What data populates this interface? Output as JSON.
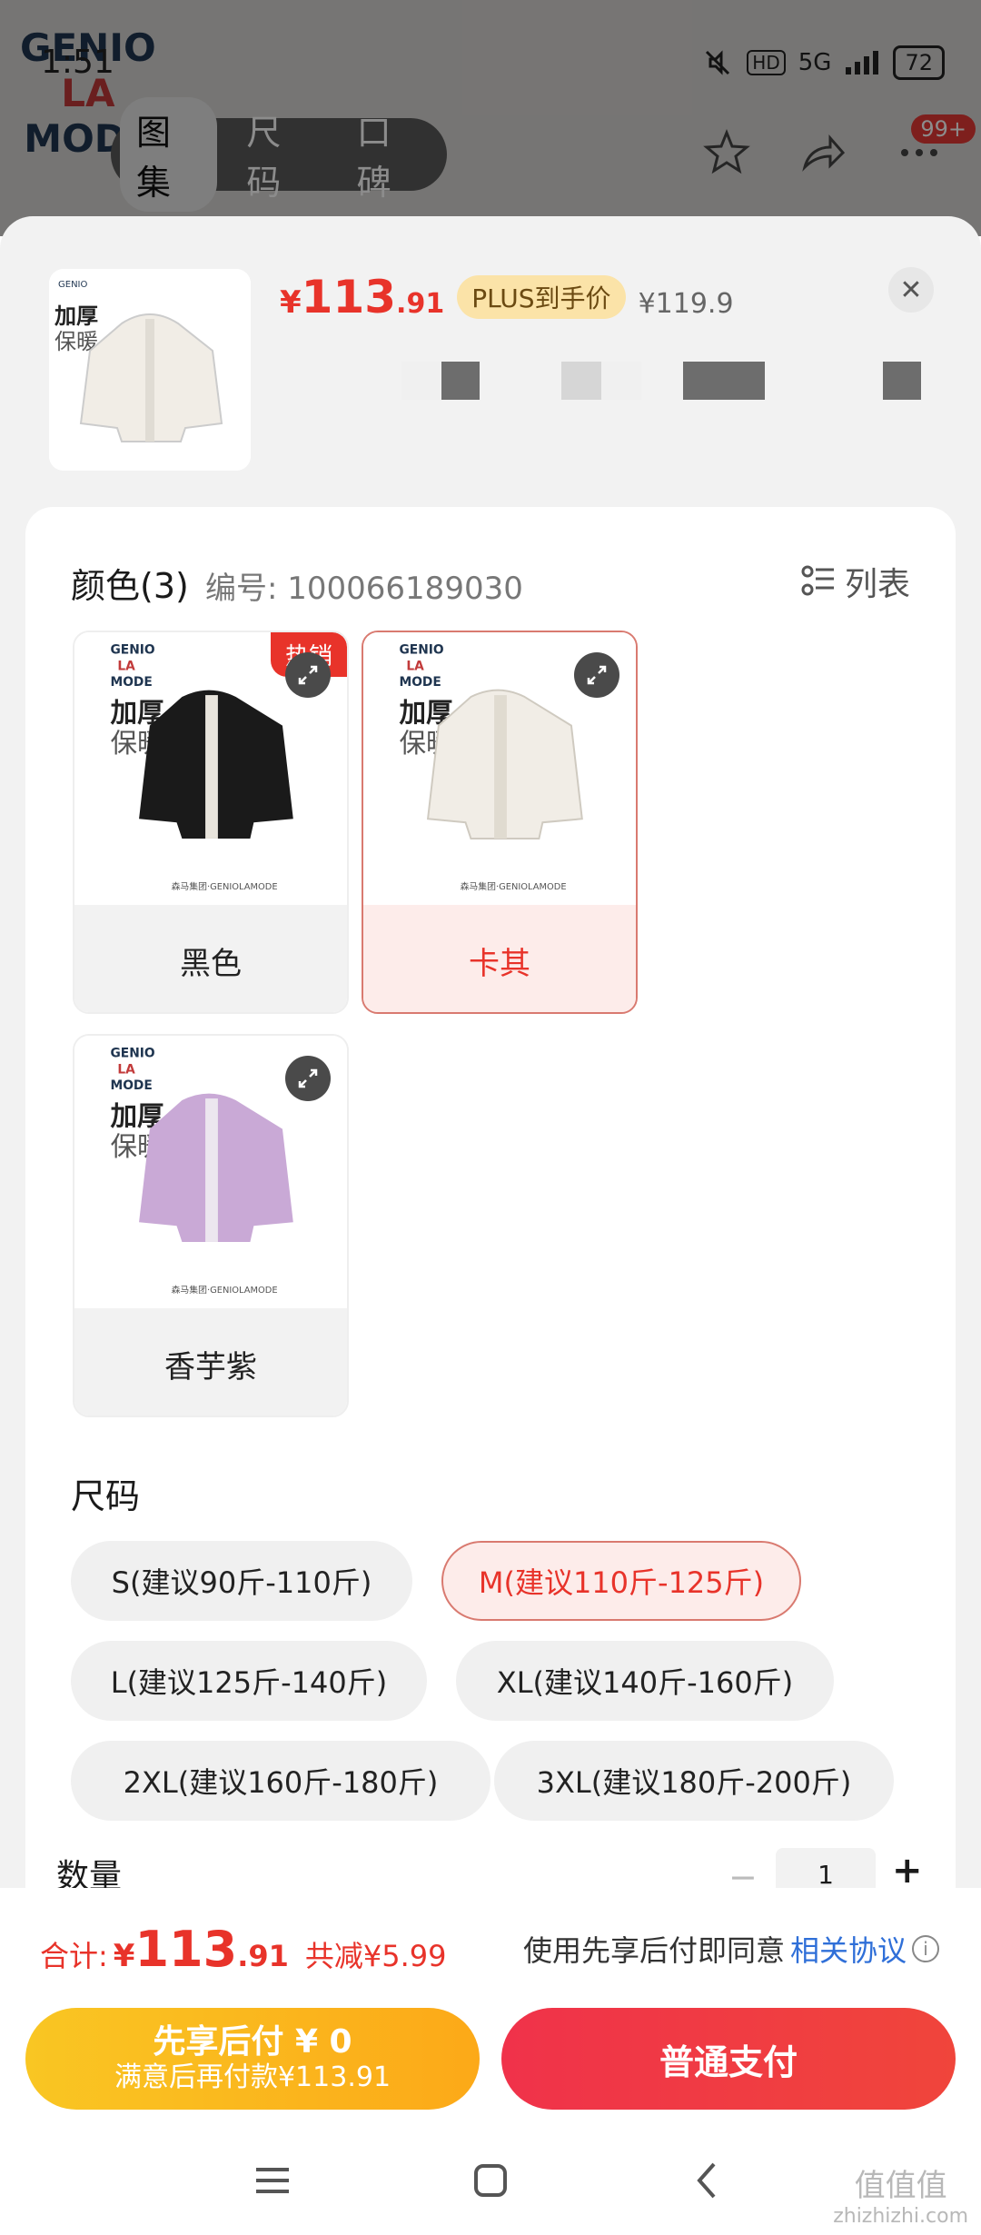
{
  "status": {
    "time": "1:51",
    "hd": "HD",
    "net": "5G",
    "battery": "72"
  },
  "bg": {
    "brand_line1": "GENIO",
    "brand_line2": "LA",
    "brand_line3": "MODE",
    "tabs": [
      "图集",
      "尺码",
      "口碑"
    ],
    "badge": "99+"
  },
  "header": {
    "currency": "¥",
    "price_int": "113",
    "price_dec": ".91",
    "plus_tag": "PLUS到手价",
    "orig_price": "¥119.9",
    "close_icon": "close-icon"
  },
  "color_section": {
    "title": "颜色(3)",
    "serial": "编号: 100066189030",
    "list_label": "列表",
    "options": [
      {
        "label": "黑色",
        "hot": "热销",
        "color": "#111111",
        "selected": false
      },
      {
        "label": "卡其",
        "hot": "",
        "color": "#f1ede6",
        "selected": true
      },
      {
        "label": "香芋紫",
        "hot": "",
        "color": "#c9a9d6",
        "selected": false
      }
    ],
    "img_text_line1": "GENIO",
    "img_text_line2": "LA",
    "img_text_line3": "MODE",
    "img_title1": "加厚",
    "img_title2": "保暖",
    "img_footer": "森马集团·GENIOLAMODE"
  },
  "size_section": {
    "title": "尺码",
    "sizes": [
      "S(建议90斤-110斤)",
      "M(建议110斤-125斤)",
      "L(建议125斤-140斤)",
      "XL(建议140斤-160斤)",
      "2XL(建议160斤-180斤)",
      "3XL(建议180斤-200斤)"
    ],
    "selected_index": 1
  },
  "quantity": {
    "label": "数量",
    "value": "1",
    "minus": "−",
    "plus": "+"
  },
  "footer": {
    "total_label": "合计:",
    "total_currency": "¥",
    "total_int": "113",
    "total_dec": ".91",
    "save": "共减¥5.99",
    "agree_prefix": "使用先享后付即同意",
    "agree_link": "相关协议",
    "info_icon": "i",
    "btn_left_line1": "先享后付 ¥ 0",
    "btn_left_line2": "满意后再付款¥113.91",
    "btn_right": "普通支付"
  },
  "watermark": {
    "line1": "值值值",
    "line2": "zhizhizhi.com"
  }
}
